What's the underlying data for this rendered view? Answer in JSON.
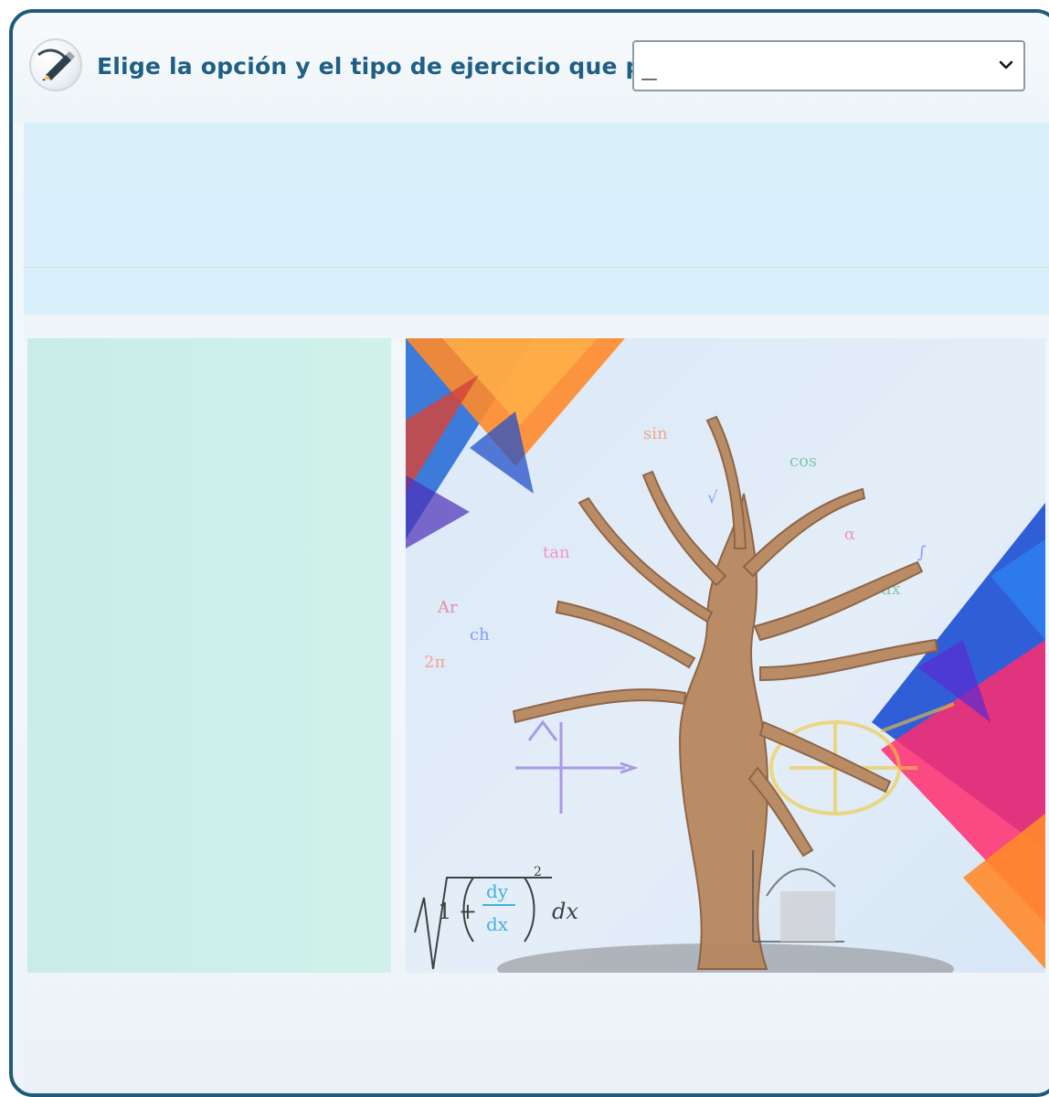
{
  "header": {
    "title": "Elige la opción y el tipo de ejercicio que prefieras",
    "select": {
      "value": "_",
      "options": [
        "_"
      ]
    }
  },
  "colors": {
    "frame": "#1f5a7a",
    "title": "#1f5f86",
    "top_panel": "#d9effa",
    "left_panel": "#cfeee8"
  },
  "image": {
    "formula": {
      "one_plus": "1 +",
      "numerator": "dy",
      "denominator": "dx",
      "exponent": "2",
      "tail": "dx"
    }
  }
}
